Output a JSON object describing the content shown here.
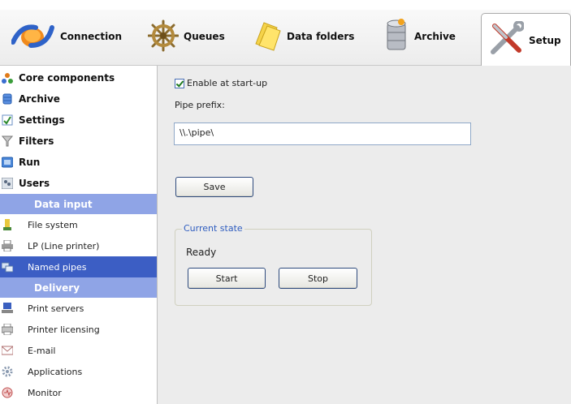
{
  "toolbar": {
    "tabs": [
      {
        "label": "Connection",
        "icon": "connection-icon"
      },
      {
        "label": "Queues",
        "icon": "helm-icon"
      },
      {
        "label": "Data folders",
        "icon": "folder-icon"
      },
      {
        "label": "Archive",
        "icon": "database-icon"
      },
      {
        "label": "Setup",
        "icon": "tools-icon",
        "active": true
      }
    ]
  },
  "sidebar": {
    "major_items": [
      {
        "label": "Core components",
        "icon": "components-icon"
      },
      {
        "label": "Archive",
        "icon": "database-icon"
      },
      {
        "label": "Settings",
        "icon": "settings-icon"
      },
      {
        "label": "Filters",
        "icon": "filter-icon"
      },
      {
        "label": "Run",
        "icon": "run-icon"
      },
      {
        "label": "Users",
        "icon": "users-icon"
      }
    ],
    "section_data_input": "Data input",
    "data_input_items": [
      {
        "label": "File system",
        "icon": "file-system-icon"
      },
      {
        "label": "LP (Line printer)",
        "icon": "line-printer-icon"
      },
      {
        "label": "Named pipes",
        "icon": "named-pipes-icon",
        "selected": true
      }
    ],
    "section_delivery": "Delivery",
    "delivery_items": [
      {
        "label": "Print servers",
        "icon": "print-server-icon"
      },
      {
        "label": "Printer licensing",
        "icon": "printer-icon"
      },
      {
        "label": "E-mail",
        "icon": "envelope-icon"
      },
      {
        "label": "Applications",
        "icon": "applications-icon"
      },
      {
        "label": "Monitor",
        "icon": "monitor-icon"
      }
    ]
  },
  "main": {
    "enable_label": "Enable at start-up",
    "enable_checked": true,
    "pipe_prefix_label": "Pipe prefix:",
    "pipe_prefix_value": "\\\\.\\pipe\\",
    "save_label": "Save",
    "state_group_label": "Current state",
    "state_value": "Ready",
    "start_label": "Start",
    "stop_label": "Stop"
  },
  "colors": {
    "selected_bg": "#3c5ec4",
    "section_bg": "#8fa4e6",
    "panel_bg": "#ececec",
    "accent_text": "#2e5cbf"
  }
}
